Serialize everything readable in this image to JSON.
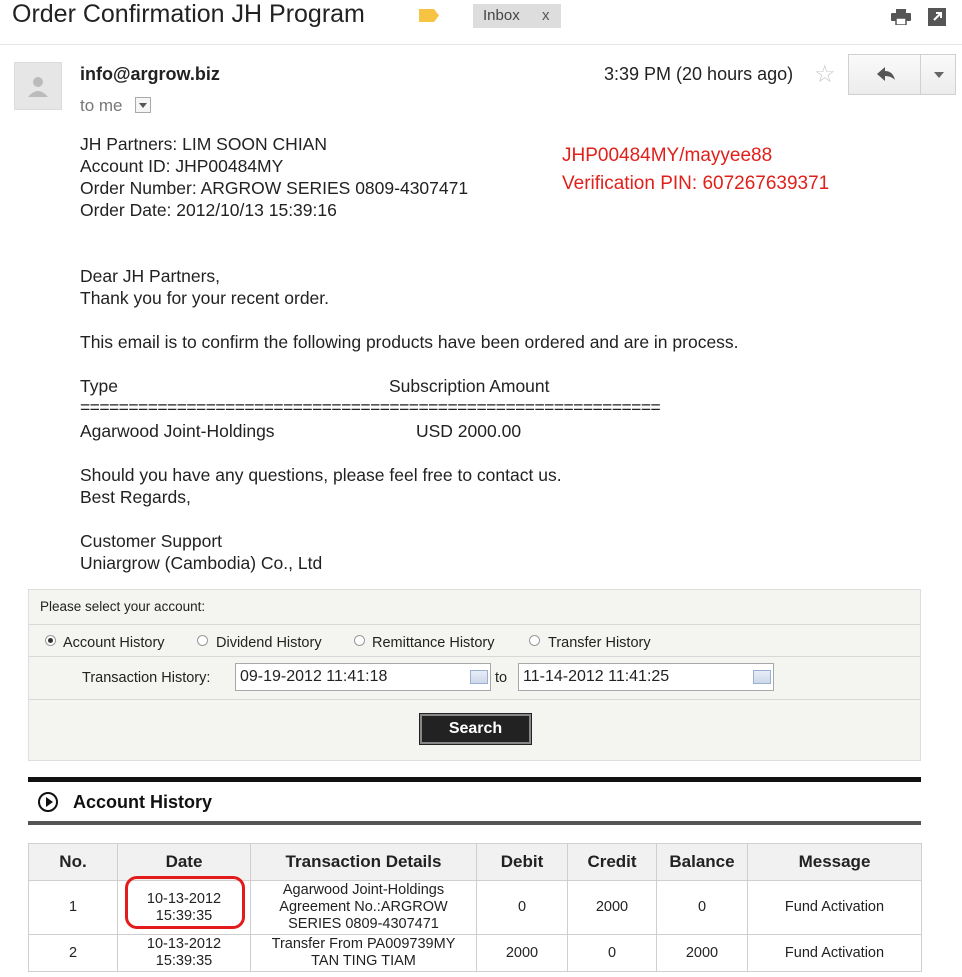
{
  "header": {
    "subject": "Order Confirmation JH Program",
    "label": "Inbox",
    "label_close": "x",
    "label_color": "#f6c342",
    "icons": [
      "print-icon",
      "new-window-icon"
    ]
  },
  "message": {
    "sender": "info@argrow.biz",
    "to": "to me",
    "time": "3:39 PM (20 hours ago)",
    "star": "☆",
    "icons": [
      "reply-icon",
      "more-dropdown-icon"
    ]
  },
  "body": {
    "partners": "JH Partners: LIM SOON CHIAN",
    "account_id": "Account ID: JHP00484MY",
    "order_number": "Order Number: ARGROW SERIES 0809-4307471",
    "order_date": "Order Date: 2012/10/13 15:39:16",
    "annotation_1": "JHP00484MY/mayyee88",
    "annotation_2": "Verification PIN: 607267639371",
    "annotation_color": "#e0201b",
    "greeting": "Dear JH Partners,",
    "thanks": "Thank you for your recent order.",
    "confirm": "This email is to confirm the following products have been ordered and are in process.",
    "col_type": "Type",
    "col_amount": "Subscription Amount",
    "separator": "============================================================",
    "item_type": "Agarwood Joint-Holdings",
    "item_amount": "USD 2000.00",
    "questions": "Should you have any questions, please feel free to contact us.",
    "regards": "Best Regards,",
    "sign_1": "Customer Support",
    "sign_2": "Uniargrow (Cambodia) Co., Ltd"
  },
  "panel": {
    "title": "Please select your account:",
    "options": [
      "Account History",
      "Dividend History",
      "Remittance History",
      "Transfer History"
    ],
    "selected": "Account History",
    "th_label": "Transaction History:",
    "from": "09-19-2012 11:41:18",
    "to_label": "to",
    "to": "11-14-2012 11:41:25",
    "search": "Search"
  },
  "history": {
    "title": "Account History",
    "columns": [
      "No.",
      "Date",
      "Transaction Details",
      "Debit",
      "Credit",
      "Balance",
      "Message"
    ],
    "rows": [
      {
        "no": "1",
        "date_1": "10-13-2012",
        "date_2": "15:39:35",
        "details_1": "Agarwood Joint-Holdings",
        "details_2": "Agreement No.:ARGROW",
        "details_3": "SERIES 0809-4307471",
        "debit": "0",
        "credit": "2000",
        "balance": "0",
        "message": "Fund Activation"
      },
      {
        "no": "2",
        "date_1": "10-13-2012",
        "date_2": "15:39:35",
        "details_1": "Transfer From PA009739MY",
        "details_2": "TAN TING TIAM",
        "details_3": "",
        "debit": "2000",
        "credit": "0",
        "balance": "2000",
        "message": "Fund Activation"
      }
    ],
    "highlight_color": "#e31b1b"
  }
}
